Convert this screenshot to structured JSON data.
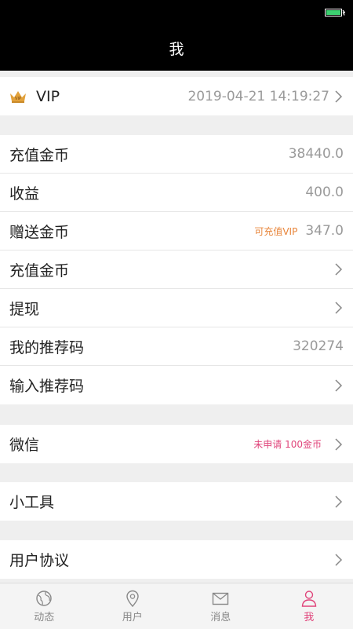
{
  "header": {
    "title": "我"
  },
  "vip": {
    "label": "VIP",
    "date": "2019-04-21 14:19:27"
  },
  "section_coins": {
    "recharge_coins": {
      "label": "充值金币",
      "value": "38440.0"
    },
    "earnings": {
      "label": "收益",
      "value": "400.0"
    },
    "gift_coins": {
      "label": "赠送金币",
      "note": "可充值VIP",
      "value": "347.0"
    },
    "recharge_action": {
      "label": "充值金币"
    },
    "withdraw": {
      "label": "提现"
    },
    "my_referral_code": {
      "label": "我的推荐码",
      "value": "320274"
    },
    "enter_referral_code": {
      "label": "输入推荐码"
    }
  },
  "wechat": {
    "label": "微信",
    "note": "未申请 100金币"
  },
  "tools": {
    "label": "小工具"
  },
  "agreement": {
    "label": "用户协议"
  },
  "tabbar": {
    "items": [
      {
        "label": "动态",
        "icon": "globe-icon"
      },
      {
        "label": "用户",
        "icon": "location-pin-icon"
      },
      {
        "label": "消息",
        "icon": "envelope-icon"
      },
      {
        "label": "我",
        "icon": "person-icon"
      }
    ],
    "active_index": 3
  },
  "colors": {
    "accent_pink": "#e0457b",
    "note_orange": "#e8853a",
    "crown_gold": "#e2a13a"
  }
}
